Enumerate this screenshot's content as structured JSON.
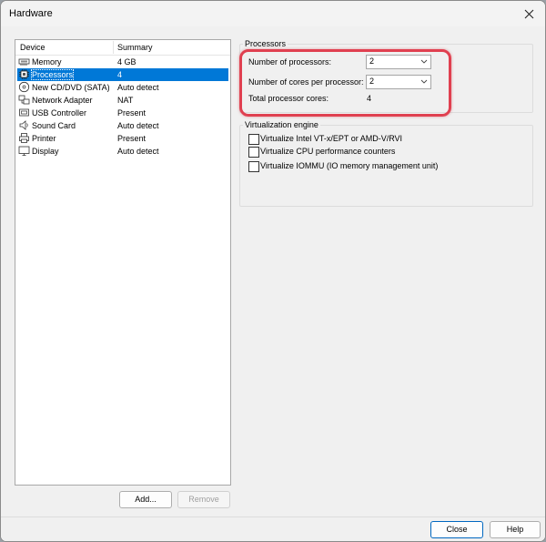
{
  "window": {
    "title": "Hardware"
  },
  "devices": {
    "header": {
      "device": "Device",
      "summary": "Summary"
    },
    "items": [
      {
        "name": "Memory",
        "summary": "4 GB",
        "icon": "memory-icon"
      },
      {
        "name": "Processors",
        "summary": "4",
        "icon": "processor-icon",
        "selected": true
      },
      {
        "name": "New CD/DVD (SATA)",
        "summary": "Auto detect",
        "icon": "cd-dvd-icon"
      },
      {
        "name": "Network Adapter",
        "summary": "NAT",
        "icon": "network-adapter-icon"
      },
      {
        "name": "USB Controller",
        "summary": "Present",
        "icon": "usb-icon"
      },
      {
        "name": "Sound Card",
        "summary": "Auto detect",
        "icon": "speaker-icon"
      },
      {
        "name": "Printer",
        "summary": "Present",
        "icon": "printer-icon"
      },
      {
        "name": "Display",
        "summary": "Auto detect",
        "icon": "display-icon"
      }
    ],
    "add_label": "Add...",
    "remove_label": "Remove"
  },
  "processors": {
    "group_label": "Processors",
    "num_processors_label": "Number of processors:",
    "num_processors_value": "2",
    "cores_label": "Number of cores per processor:",
    "cores_value": "2",
    "total_label": "Total processor cores:",
    "total_value": "4"
  },
  "virtualization": {
    "group_label": "Virtualization engine",
    "options": [
      {
        "label": "Virtualize Intel VT-x/EPT or AMD-V/RVI",
        "checked": false
      },
      {
        "label": "Virtualize CPU performance counters",
        "checked": false
      },
      {
        "label": "Virtualize IOMMU (IO memory management unit)",
        "checked": false
      }
    ]
  },
  "footer": {
    "close_label": "Close",
    "help_label": "Help"
  },
  "colors": {
    "selection": "#0078d7",
    "highlight": "#e04050"
  }
}
